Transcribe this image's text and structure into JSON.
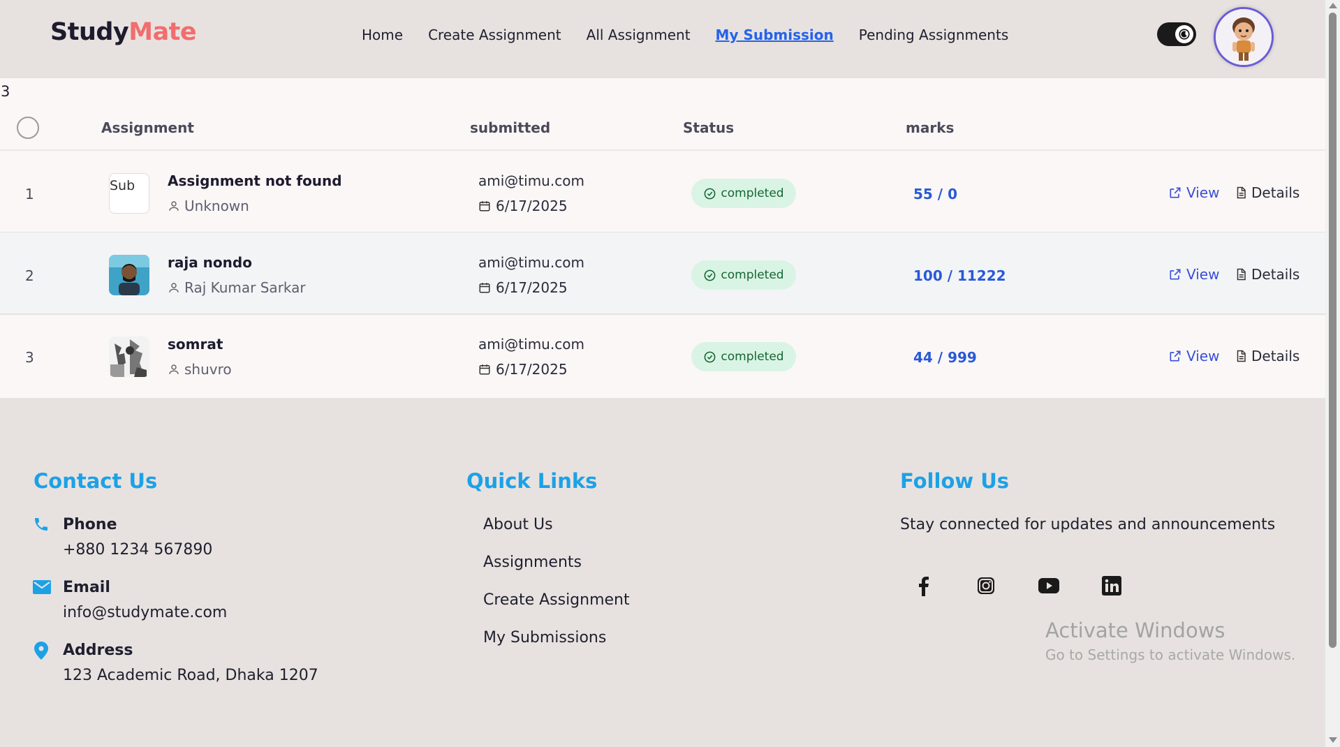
{
  "nav": {
    "logo_part1": "Study",
    "logo_part2": "Mate",
    "links": [
      "Home",
      "Create Assignment",
      "All Assignment",
      "My Submission",
      "Pending Assignments"
    ],
    "active_link": "My Submission"
  },
  "table": {
    "count": "3",
    "headers": {
      "assignment": "Assignment",
      "submitted": "submitted",
      "status": "Status",
      "marks": "marks"
    },
    "rows": [
      {
        "num": "1",
        "thumb_alt": "Sub",
        "title": "Assignment not found",
        "user": "Unknown",
        "email": "ami@timu.com",
        "date": "6/17/2025",
        "status": "completed",
        "marks": "55 / 0",
        "view": "View",
        "details": "Details"
      },
      {
        "num": "2",
        "thumb_alt": "",
        "title": "raja nondo",
        "user": "Raj Kumar Sarkar",
        "email": "ami@timu.com",
        "date": "6/17/2025",
        "status": "completed",
        "marks": "100 / 11222",
        "view": "View",
        "details": "Details"
      },
      {
        "num": "3",
        "thumb_alt": "",
        "title": "somrat",
        "user": "shuvro",
        "email": "ami@timu.com",
        "date": "6/17/2025",
        "status": "completed",
        "marks": "44 / 999",
        "view": "View",
        "details": "Details"
      }
    ]
  },
  "footer": {
    "contact": {
      "heading": "Contact Us",
      "phone_label": "Phone",
      "phone": "+880 1234 567890",
      "email_label": "Email",
      "email": "info@studymate.com",
      "address_label": "Address",
      "address": "123 Academic Road, Dhaka 1207"
    },
    "quick_links": {
      "heading": "Quick Links",
      "links": [
        "About Us",
        "Assignments",
        "Create Assignment",
        "My Submissions"
      ]
    },
    "follow": {
      "heading": "Follow Us",
      "text": "Stay connected for updates and announcements",
      "icons": [
        "facebook-icon",
        "instagram-icon",
        "youtube-icon",
        "linkedin-icon"
      ]
    }
  },
  "watermark": {
    "line1": "Activate Windows",
    "line2": "Go to Settings to activate Windows."
  },
  "colors": {
    "accent": "#1da1e6",
    "brand": "#f26d6d",
    "active_link": "#2463eb",
    "status_bg": "#d9f4e4"
  }
}
